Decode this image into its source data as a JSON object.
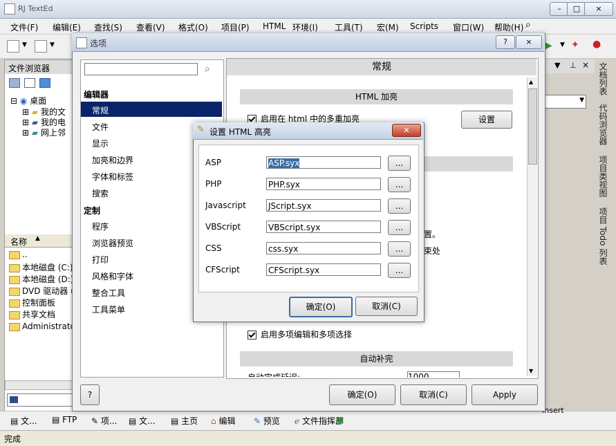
{
  "app": {
    "title": "RJ TextEd",
    "menu": [
      "文件(F)",
      "编辑(E)",
      "查找(S)",
      "查看(V)",
      "格式(O)",
      "项目(P)",
      "HTML",
      "环境(I)",
      "工具(T)",
      "宏(M)",
      "Scripts",
      "窗口(W)",
      "帮助(H)"
    ]
  },
  "file_browser": {
    "header": "文件浏览器",
    "tree": [
      "桌面",
      "我的文",
      "我的电",
      "网上邻"
    ],
    "list_header": "名称",
    "list_items": [
      "..",
      "本地磁盘 (C:)",
      "本地磁盘 (D:)",
      "DVD 驱动器 (E",
      "控制面板",
      "共享文档",
      "Administrator的"
    ]
  },
  "side_tabs": [
    "文档列表",
    "代码浏览器",
    "项目类视图",
    "项目 Todo 列表"
  ],
  "bottom_tabs": [
    "文...",
    "FTP",
    "项...",
    "文...",
    "主页",
    "编辑",
    "预览",
    "文件指挥部"
  ],
  "status": {
    "text": "完成",
    "right": "Insert"
  },
  "options_dialog": {
    "title": "选项",
    "help_glyph": "?",
    "close_glyph": "×",
    "search_placeholder": "",
    "nav": {
      "editor_header": "编辑器",
      "editor_items": [
        "常规",
        "文件",
        "显示",
        "加亮和边界",
        "字体和标签",
        "搜索"
      ],
      "custom_header": "定制",
      "custom_items": [
        "程序",
        "浏览器预览",
        "打印",
        "风格和字体",
        "整合工具",
        "工具菜单"
      ],
      "selected": "常规"
    },
    "panel_title": "常规",
    "html_section": "HTML 加亮",
    "enable_multi_highlight": "启用在 html 中的多重加亮",
    "settings_button": "设置",
    "partial_text_1": "置。",
    "partial_text_2": "束处",
    "multi_edit_label": "启用多项编辑和多项选择",
    "autocomplete_section": "自动补完",
    "autocomplete_delay_label": "自动完成延迟:",
    "autocomplete_delay_value": "1000",
    "help_button": "?",
    "ok": "确定(O)",
    "cancel": "取消(C)",
    "apply": "Apply"
  },
  "html_highlight_dialog": {
    "title": "设置 HTML 高亮",
    "close_glyph": "×",
    "rows": [
      {
        "label": "ASP",
        "value": "ASP.syx",
        "browse": "..."
      },
      {
        "label": "PHP",
        "value": "PHP.syx",
        "browse": "..."
      },
      {
        "label": "Javascript",
        "value": "JScript.syx",
        "browse": "..."
      },
      {
        "label": "VBScript",
        "value": "VBScript.syx",
        "browse": "..."
      },
      {
        "label": "CSS",
        "value": "css.syx",
        "browse": "..."
      },
      {
        "label": "CFScript",
        "value": "CFScript.syx",
        "browse": "..."
      }
    ],
    "ok": "确定(O)",
    "cancel": "取消(C)"
  },
  "colors": {
    "nav_selected": "#0a246a",
    "accent": "#2b6fb7"
  }
}
